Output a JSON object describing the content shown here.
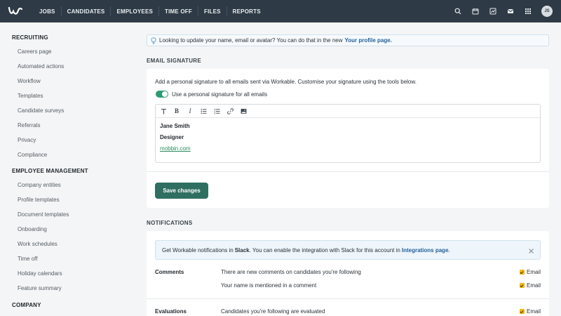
{
  "nav": {
    "items": [
      "JOBS",
      "CANDIDATES",
      "EMPLOYEES",
      "TIME OFF",
      "FILES",
      "REPORTS"
    ],
    "user_initials": "JS"
  },
  "sidebar": {
    "recruiting_heading": "RECRUITING",
    "recruiting_items": [
      "Careers page",
      "Automated actions",
      "Workflow",
      "Templates",
      "Candidate surveys",
      "Referrals",
      "Privacy",
      "Compliance"
    ],
    "employee_heading": "EMPLOYEE MANAGEMENT",
    "employee_items": [
      "Company entities",
      "Profile templates",
      "Document templates",
      "Onboarding",
      "Work schedules",
      "Time off",
      "Holiday calendars",
      "Feature summary"
    ],
    "company_heading": "COMPANY"
  },
  "banner": {
    "text": "Looking to update your name, email or avatar? You can do that in the new ",
    "link": "Your profile page."
  },
  "signature": {
    "section_label": "EMAIL SIGNATURE",
    "description": "Add a personal signature to all emails sent via Workable. Customise your signature using the tools below.",
    "toggle_label": "Use a personal signature for all emails",
    "name": "Jane Smith",
    "title": "Designer",
    "website": "mobbin.com",
    "save_label": "Save changes"
  },
  "notifications": {
    "section_label": "NOTIFICATIONS",
    "slack_prefix": "Get Workable notifications in ",
    "slack_bold": "Slack",
    "slack_middle": ". You can enable the integration with Slack for this account in ",
    "slack_link": "Integrations page",
    "slack_suffix": ".",
    "rows": [
      {
        "label": "Comments",
        "desc": "There are new comments on candidates you're following",
        "check": "Email"
      },
      {
        "label": "",
        "desc": "Your name is mentioned in a comment",
        "check": "Email"
      },
      {
        "label": "Evaluations",
        "desc": "Candidates you're following are evaluated",
        "check": "Email"
      }
    ]
  },
  "colors": {
    "topbar": "#2e3a45",
    "accent_green": "#2f6f62",
    "toggle_green": "#2d9b74",
    "checkbox_yellow": "#f2b705",
    "link_blue": "#1f5f9e"
  }
}
